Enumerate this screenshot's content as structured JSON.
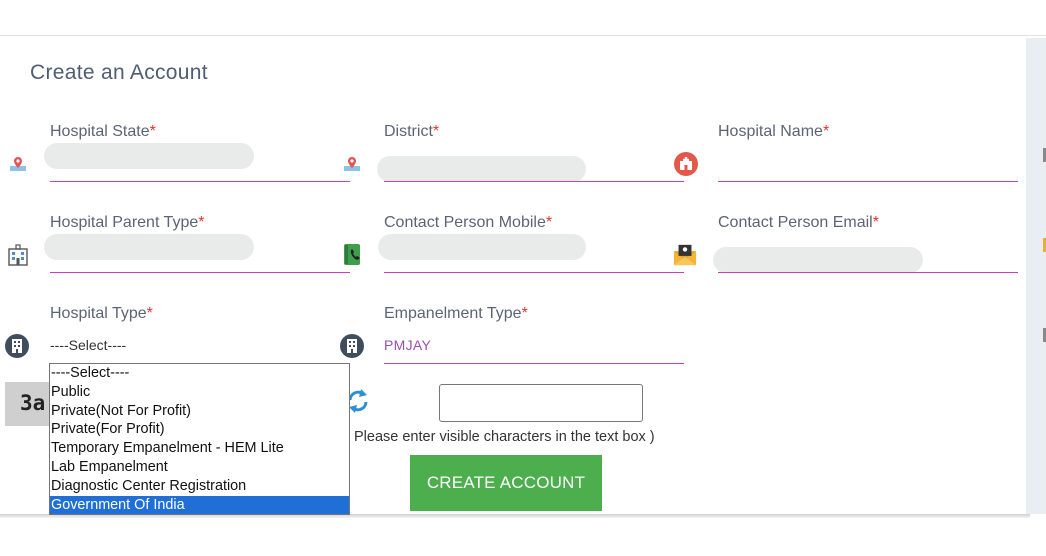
{
  "form": {
    "title": "Create an Account",
    "fields": {
      "hospital_state": {
        "label": "Hospital State",
        "required_mark": "*"
      },
      "district": {
        "label": "District",
        "required_mark": "*"
      },
      "hospital_name": {
        "label": "Hospital Name",
        "required_mark": "*"
      },
      "hospital_parent_type": {
        "label": "Hospital Parent Type",
        "required_mark": "*"
      },
      "contact_mobile": {
        "label": "Contact Person Mobile",
        "required_mark": "*"
      },
      "contact_email": {
        "label": "Contact Person Email",
        "required_mark": "*"
      },
      "hospital_type": {
        "label": "Hospital Type",
        "required_mark": "*",
        "value": "----Select----"
      },
      "empanelment_type": {
        "label": "Empanelment Type",
        "required_mark": "*",
        "value": "PMJAY"
      }
    },
    "hospital_type_options": [
      "----Select----",
      "Public",
      "Private(Not For Profit)",
      "Private(For Profit)",
      "Temporary Empanelment - HEM Lite",
      "Lab Empanelment",
      "Diagnostic Center Registration",
      "Government Of India"
    ],
    "hospital_type_highlighted": "Government Of India",
    "captcha": {
      "text": "3a",
      "hint": "Please enter visible characters in the text box )"
    },
    "submit_label": "CREATE ACCOUNT"
  },
  "colors": {
    "accent_underline": "#c93fc3",
    "required": "#e3342f",
    "button": "#4cae4c",
    "highlight": "#1f6fd6"
  },
  "icons": [
    "map-pin-icon",
    "hospital-icon",
    "building-icon",
    "phone-book-icon",
    "envelope-icon",
    "refresh-icon"
  ]
}
